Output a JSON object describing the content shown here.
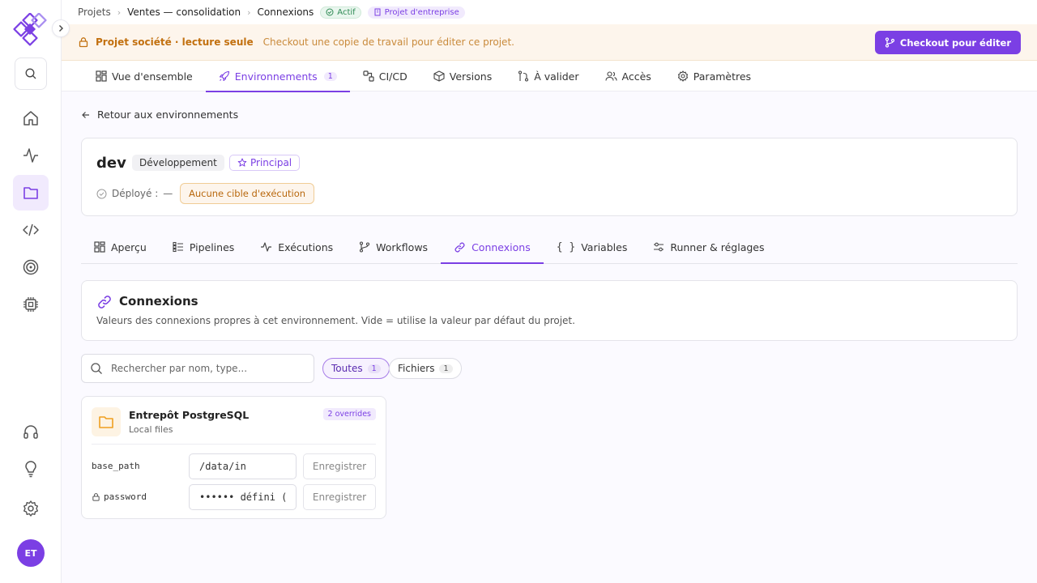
{
  "breadcrumb": {
    "root": "Projets",
    "project": "Ventes — consolidation",
    "current": "Connexions"
  },
  "status": {
    "actif": "Actif",
    "enterprise": "Projet d'entreprise"
  },
  "banner": {
    "title": "Projet société · lecture seule",
    "text": "Checkout une copie de travail pour éditer ce projet.",
    "button": "Checkout pour éditer"
  },
  "project_tabs": [
    {
      "label": "Vue d'ensemble",
      "icon": "grid-icon"
    },
    {
      "label": "Environnements",
      "icon": "rocket-icon",
      "count": "1",
      "active": true
    },
    {
      "label": "CI/CD",
      "icon": "cicd-icon"
    },
    {
      "label": "Versions",
      "icon": "box-icon"
    },
    {
      "label": "À valider",
      "icon": "merge-icon"
    },
    {
      "label": "Accès",
      "icon": "users-icon"
    },
    {
      "label": "Paramètres",
      "icon": "gear-icon"
    }
  ],
  "back_link": "Retour aux environnements",
  "environment": {
    "name": "dev",
    "type": "Développement",
    "principal": "Principal",
    "deployed_label": "Déployé :",
    "deployed_value": "—",
    "target_badge": "Aucune cible d'exécution"
  },
  "env_tabs": [
    {
      "label": "Aperçu"
    },
    {
      "label": "Pipelines"
    },
    {
      "label": "Exécutions"
    },
    {
      "label": "Workflows"
    },
    {
      "label": "Connexions",
      "active": true
    },
    {
      "label": "Variables"
    },
    {
      "label": "Runner & réglages"
    }
  ],
  "connections": {
    "title": "Connexions",
    "description": "Valeurs des connexions propres à cet environnement. Vide = utilise la valeur par défaut du projet."
  },
  "search": {
    "placeholder": "Rechercher par nom, type..."
  },
  "filters": [
    {
      "label": "Toutes",
      "count": "1",
      "active": true
    },
    {
      "label": "Fichiers",
      "count": "1"
    }
  ],
  "resource": {
    "name": "Entrepôt PostgreSQL",
    "type": "Local files",
    "overrides": "2 overrides",
    "fields": [
      {
        "label": "base_path",
        "value": "/data/in",
        "button": "Enregistrer"
      },
      {
        "label": "password",
        "value": "•••••• défini (",
        "button": "Enregistrer",
        "locked": true
      }
    ]
  },
  "user": {
    "initials": "ET"
  },
  "colors": {
    "accent": "#7b3fe4",
    "warning": "#c2700f",
    "success": "#2f8b55"
  }
}
